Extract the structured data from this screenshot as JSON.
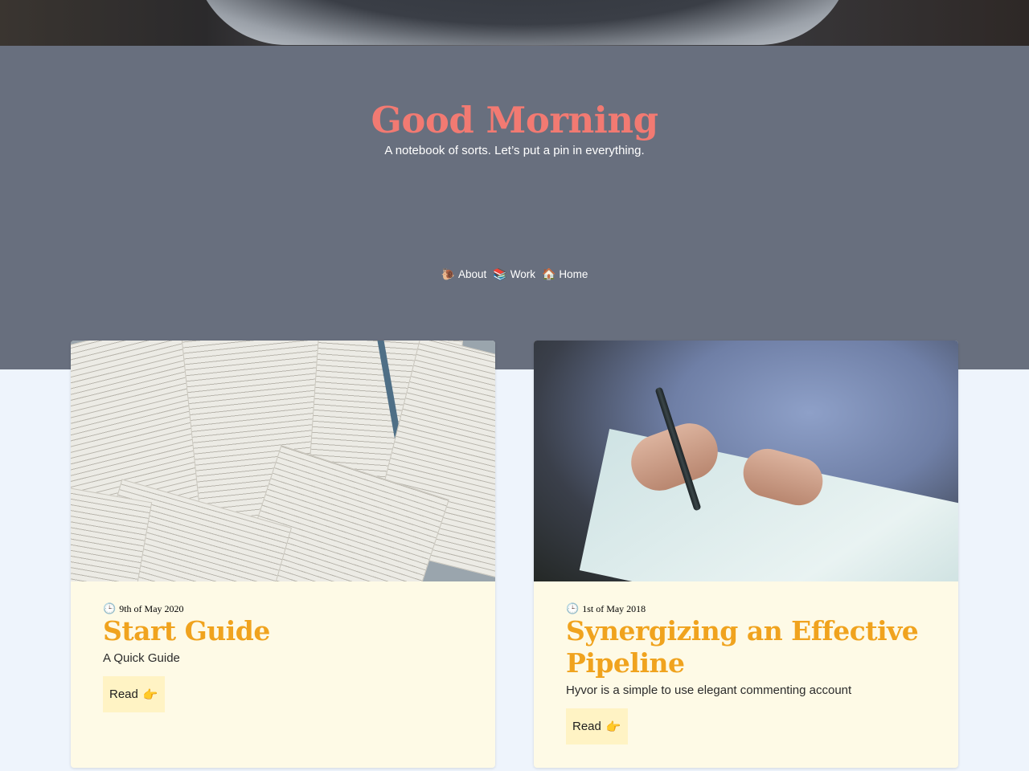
{
  "header": {
    "title": "Good Morning",
    "subtitle": "A notebook of sorts. Let’s put a pin in everything."
  },
  "nav": {
    "items": [
      {
        "icon": "snail-icon",
        "emoji": "🐌",
        "label": "About"
      },
      {
        "icon": "books-icon",
        "emoji": "📚",
        "label": "Work"
      },
      {
        "icon": "house-icon",
        "emoji": "🏠",
        "label": "Home"
      }
    ]
  },
  "posts": [
    {
      "date_icon": "clock-icon",
      "date_emoji": "🕒",
      "date": "9th of May 2020",
      "title": "Start Guide",
      "description": "A Quick Guide",
      "read_label": "Read",
      "read_emoji": "👉",
      "image": "open-books-photo"
    },
    {
      "date_icon": "clock-icon",
      "date_emoji": "🕒",
      "date": "1st of May 2018",
      "title": "Synergizing an Effective Pipeline",
      "description": "Hyvor is a simple to use elegant commenting account",
      "read_label": "Read",
      "read_emoji": "👉",
      "image": "writing-hand-photo"
    }
  ],
  "colors": {
    "hero_bg": "#686f7e",
    "title": "#f27a72",
    "post_title": "#f0a31e",
    "card_bg": "#fefae6",
    "button_bg": "#fff3c4",
    "page_bg": "#eef4fc"
  }
}
